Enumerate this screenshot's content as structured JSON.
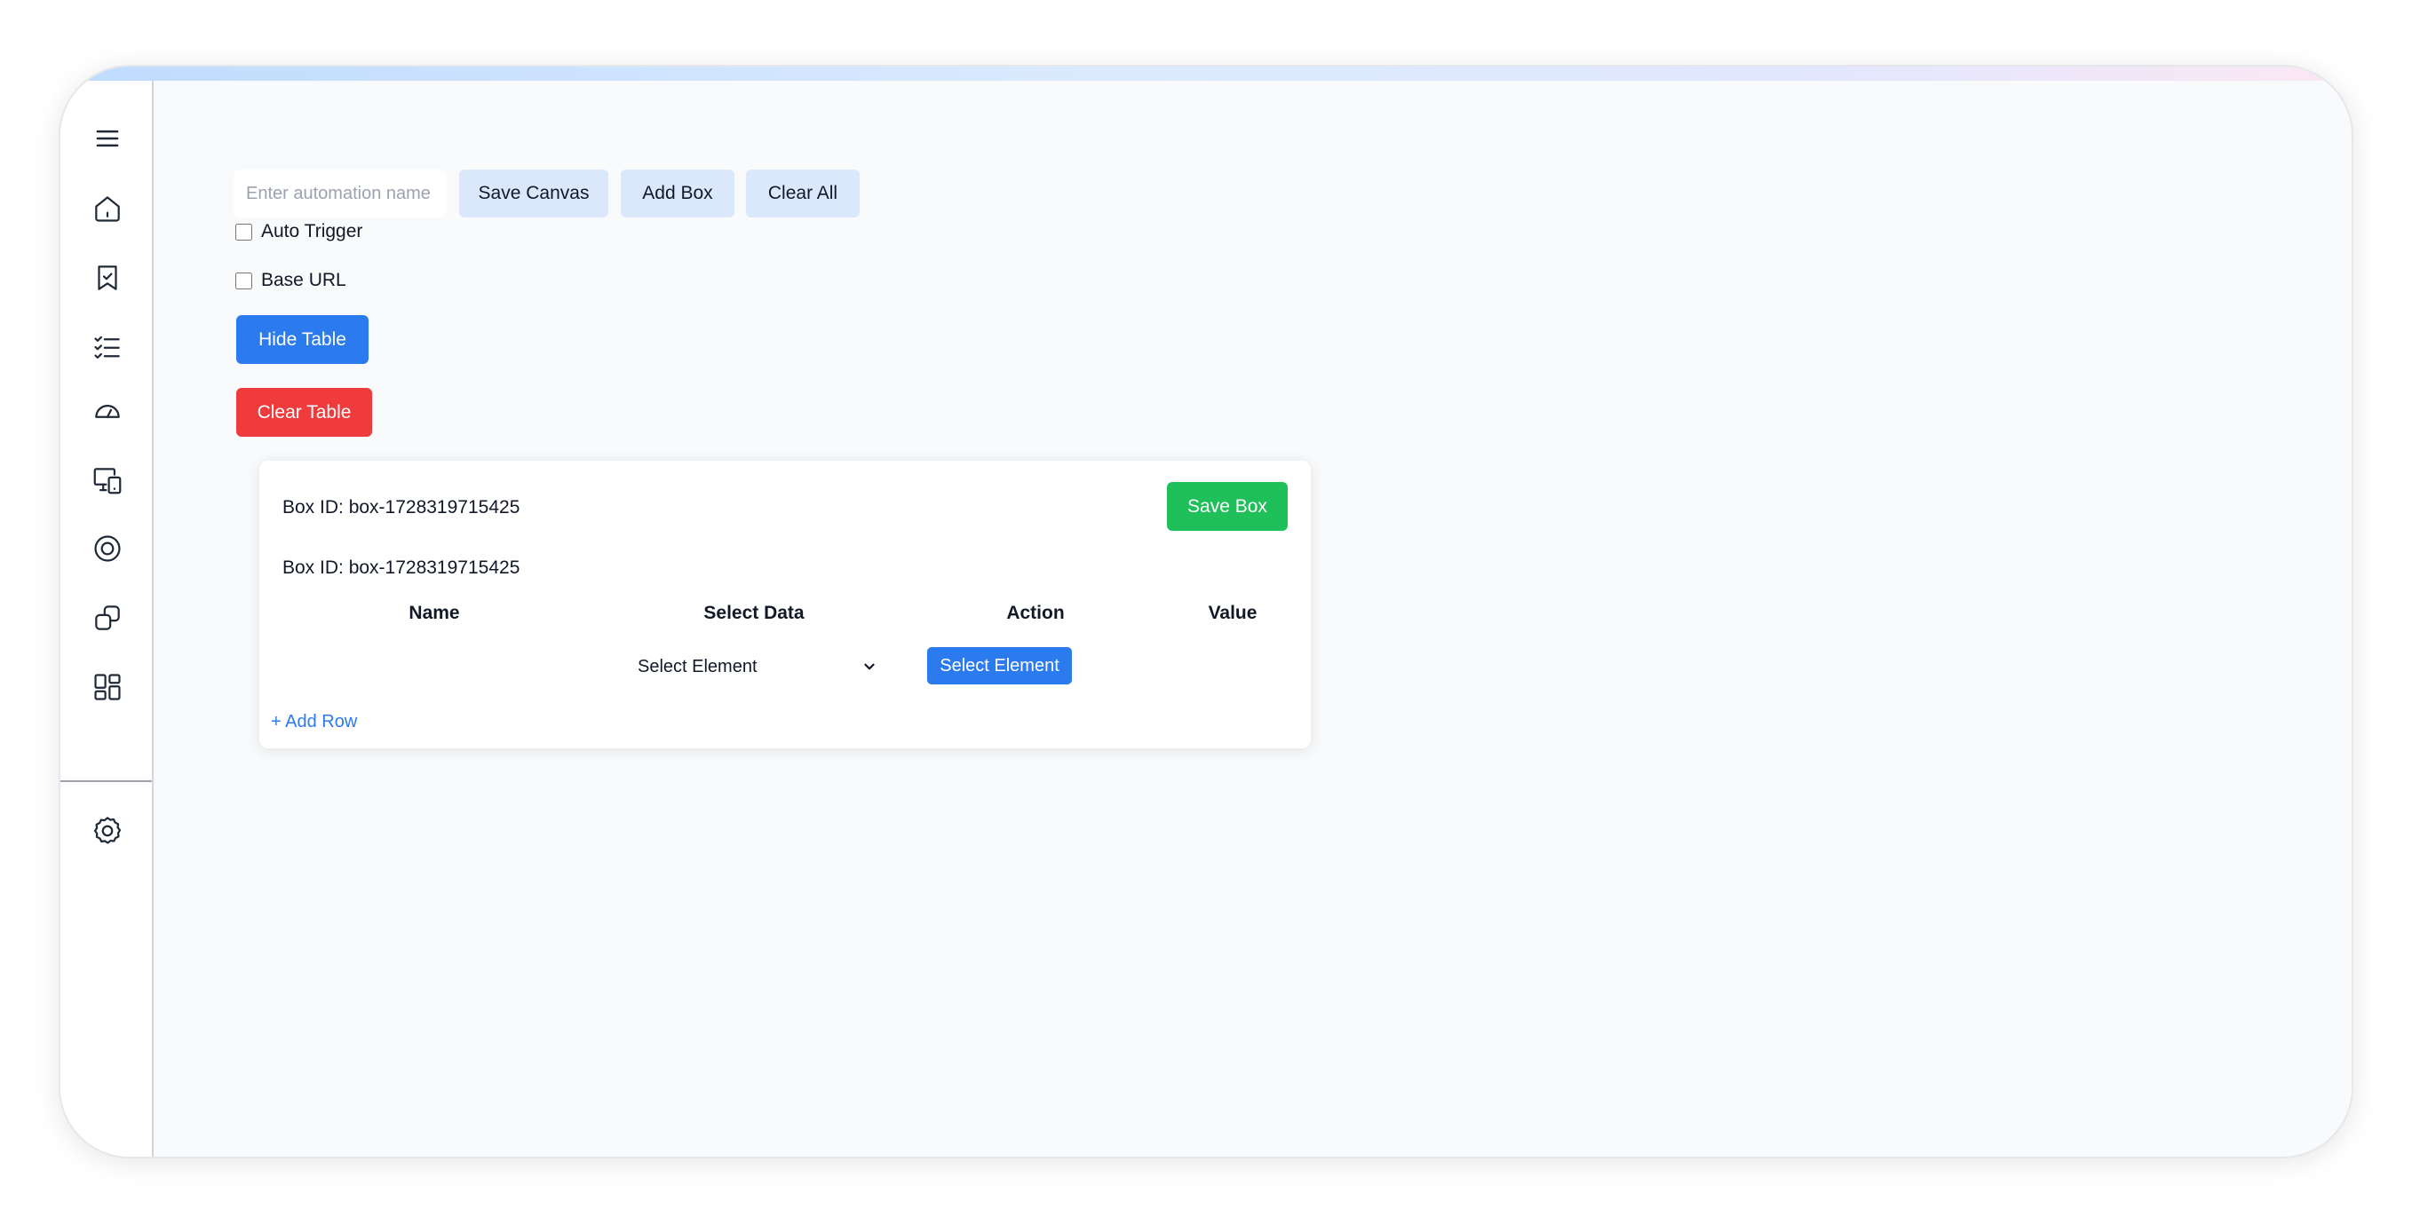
{
  "toolbar": {
    "name_placeholder": "Enter automation name",
    "name_value": "",
    "save_canvas_label": "Save Canvas",
    "add_box_label": "Add Box",
    "clear_all_label": "Clear All"
  },
  "options": {
    "auto_trigger_label": "Auto Trigger",
    "auto_trigger_checked": false,
    "base_url_label": "Base URL",
    "base_url_checked": false
  },
  "actions": {
    "hide_table_label": "Hide Table",
    "clear_table_label": "Clear Table"
  },
  "box": {
    "header_id": "Box ID: box-1728319715425",
    "sub_id": "Box ID: box-1728319715425",
    "save_label": "Save Box",
    "columns": [
      "Name",
      "Select Data",
      "Action",
      "Value"
    ],
    "rows": [
      {
        "name": "",
        "select_data": "Select Element",
        "action_label": "Select Element",
        "value": ""
      }
    ],
    "add_row_label": "+ Add Row"
  },
  "sidebar": {
    "items": [
      {
        "icon": "menu-icon"
      },
      {
        "icon": "home-icon"
      },
      {
        "icon": "bookmark-check-icon"
      },
      {
        "icon": "checklist-icon"
      },
      {
        "icon": "gauge-icon"
      },
      {
        "icon": "devices-icon"
      },
      {
        "icon": "target-icon"
      },
      {
        "icon": "copy-icon"
      },
      {
        "icon": "dashboard-icon"
      },
      {
        "icon": "settings-icon"
      }
    ]
  },
  "colors": {
    "primary": "#2b7bef",
    "danger": "#ef3b3b",
    "success": "#1fbf5a",
    "toolbar_button": "#dbe8fb",
    "canvas_bg": "#f8fafc"
  }
}
